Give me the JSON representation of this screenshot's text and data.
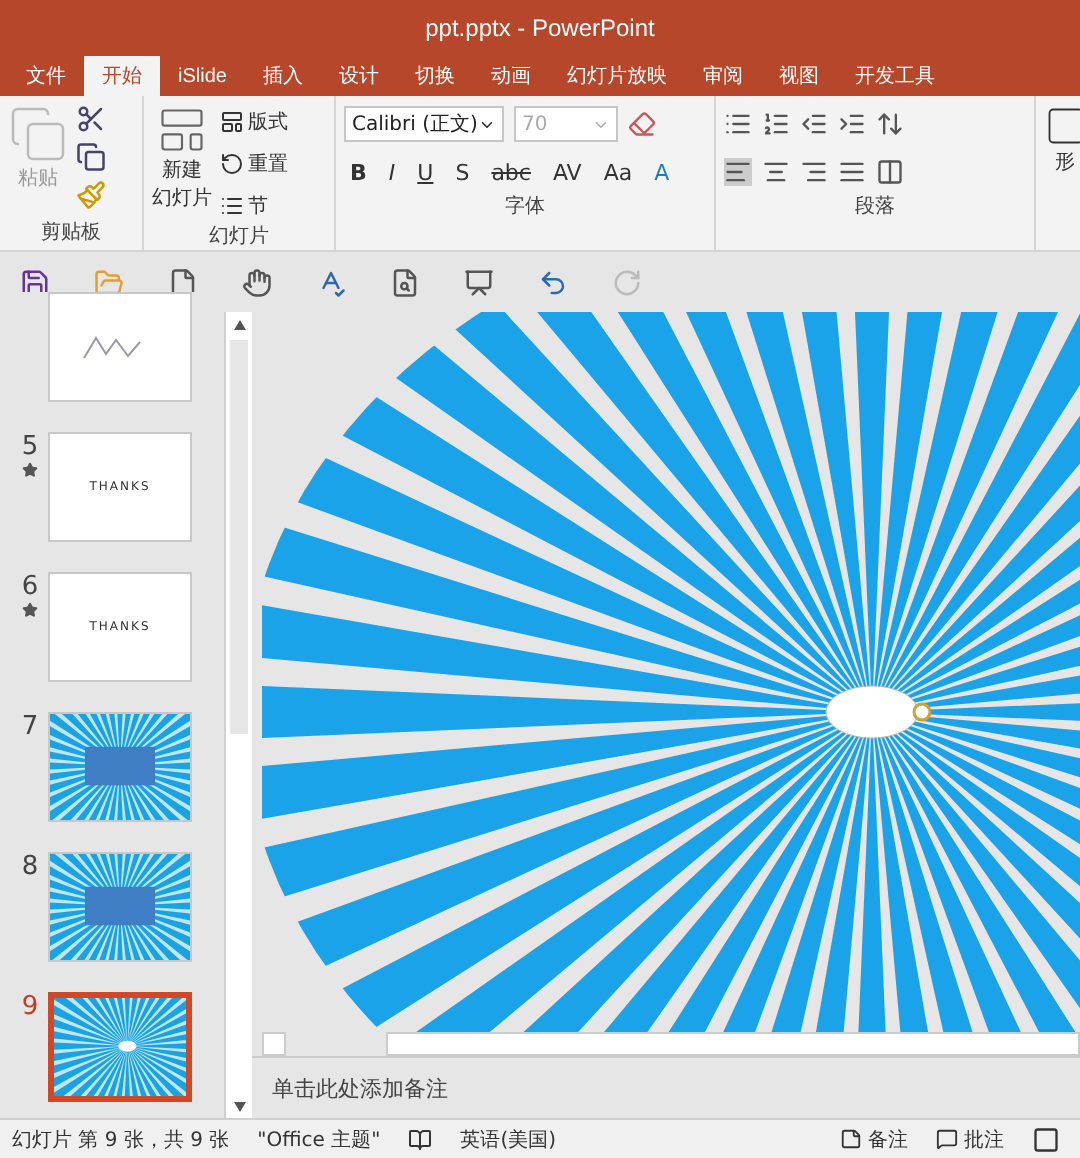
{
  "window": {
    "title": "ppt.pptx - PowerPoint"
  },
  "tabs": [
    {
      "label": "文件",
      "selected": false
    },
    {
      "label": "开始",
      "selected": true
    },
    {
      "label": "iSlide",
      "selected": false
    },
    {
      "label": "插入",
      "selected": false
    },
    {
      "label": "设计",
      "selected": false
    },
    {
      "label": "切换",
      "selected": false
    },
    {
      "label": "动画",
      "selected": false
    },
    {
      "label": "幻灯片放映",
      "selected": false
    },
    {
      "label": "审阅",
      "selected": false
    },
    {
      "label": "视图",
      "selected": false
    },
    {
      "label": "开发工具",
      "selected": false
    }
  ],
  "ribbon": {
    "clipboard": {
      "label": "剪贴板",
      "paste": {
        "label": "粘贴",
        "disabled": true
      }
    },
    "slides": {
      "label": "幻灯片",
      "new_slide": [
        "新建",
        "幻灯片"
      ],
      "items": [
        "版式",
        "重置",
        "节"
      ]
    },
    "font": {
      "label": "字体",
      "font_name": "Calibri (正文)",
      "font_size": {
        "value": "70",
        "disabled": true
      },
      "buttons": [
        "B",
        "I",
        "U",
        "S",
        "abc",
        "AV",
        "Aa",
        "A"
      ]
    },
    "paragraph": {
      "label": "段落"
    },
    "cut_off": "形"
  },
  "quick_access": {
    "redo_disabled": true
  },
  "slides": [
    {
      "starred": false,
      "kind": "chart",
      "selected": false
    },
    {
      "number": "5",
      "starred": true,
      "kind": "text",
      "text": "THANKS",
      "selected": false
    },
    {
      "number": "6",
      "starred": true,
      "kind": "text",
      "text": "THANKS",
      "selected": false
    },
    {
      "number": "7",
      "starred": false,
      "kind": "sunburst-title",
      "selected": false
    },
    {
      "number": "8",
      "starred": false,
      "kind": "sunburst-title",
      "selected": false
    },
    {
      "number": "9",
      "starred": false,
      "kind": "sunburst",
      "selected": true
    }
  ],
  "notes": {
    "placeholder": "单击此处添加备注"
  },
  "status_bar": {
    "slide_info": "幻灯片 第 9 张，共 9 张",
    "theme": "\"Office 主题\"",
    "language": "英语(美国)",
    "notes": "备注",
    "comments": "批注"
  }
}
